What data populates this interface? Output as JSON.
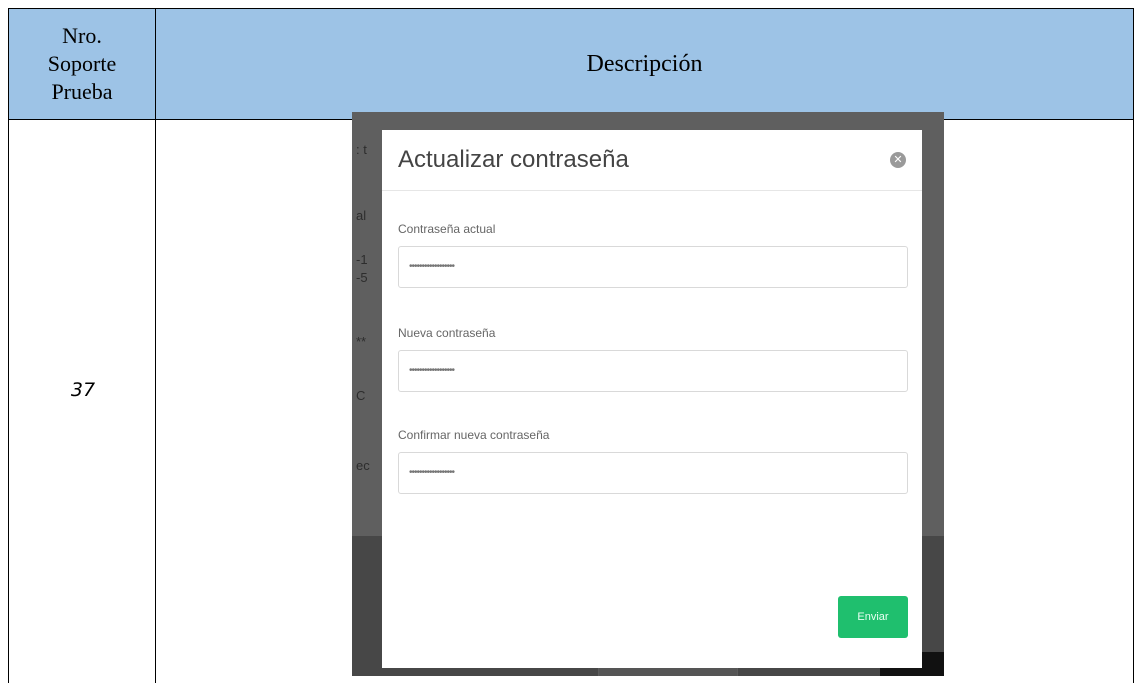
{
  "table": {
    "header_left": "Nro.\nSoporte\nPrueba",
    "header_right": "Descripción",
    "row_number": "37"
  },
  "modal": {
    "title": "Actualizar contraseña",
    "fields": [
      {
        "label": "Contraseña actual",
        "value": "••••••••••••••••••"
      },
      {
        "label": "Nueva contraseña",
        "value": "••••••••••••••••••"
      },
      {
        "label": "Confirmar nueva contraseña",
        "value": "••••••••••••••••••"
      }
    ],
    "submit_label": "Enviar"
  },
  "colors": {
    "header_bg": "#9dc3e6",
    "submit_bg": "#1fbf6e"
  }
}
